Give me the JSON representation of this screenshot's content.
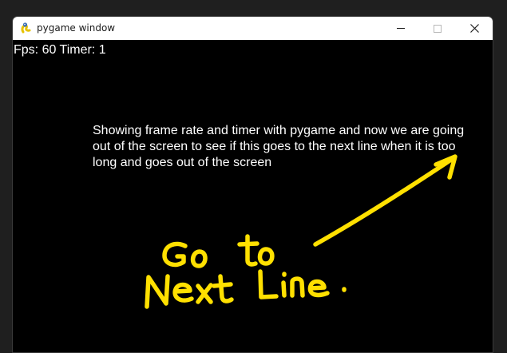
{
  "window": {
    "title": "pygame window",
    "app_icon": "pygame-snake-icon",
    "controls": {
      "minimize_icon": "minimize-icon",
      "maximize_icon": "maximize-icon",
      "close_icon": "close-icon"
    }
  },
  "game": {
    "fps_line": "Fps: 60 Timer: 1",
    "paragraph_lines": [
      "Showing frame rate and timer with pygame and now we are going",
      "out of the screen to see if this goes to the next line when it is too",
      "long and goes out of the screen"
    ]
  },
  "annotation": {
    "handwritten_text": "Go to Next Line.",
    "arrow_icon": "hand-drawn-arrow-icon",
    "color": "#ffe000"
  },
  "colors": {
    "background": "#000000",
    "text": "#ffffff",
    "titlebar": "#ffffff"
  }
}
